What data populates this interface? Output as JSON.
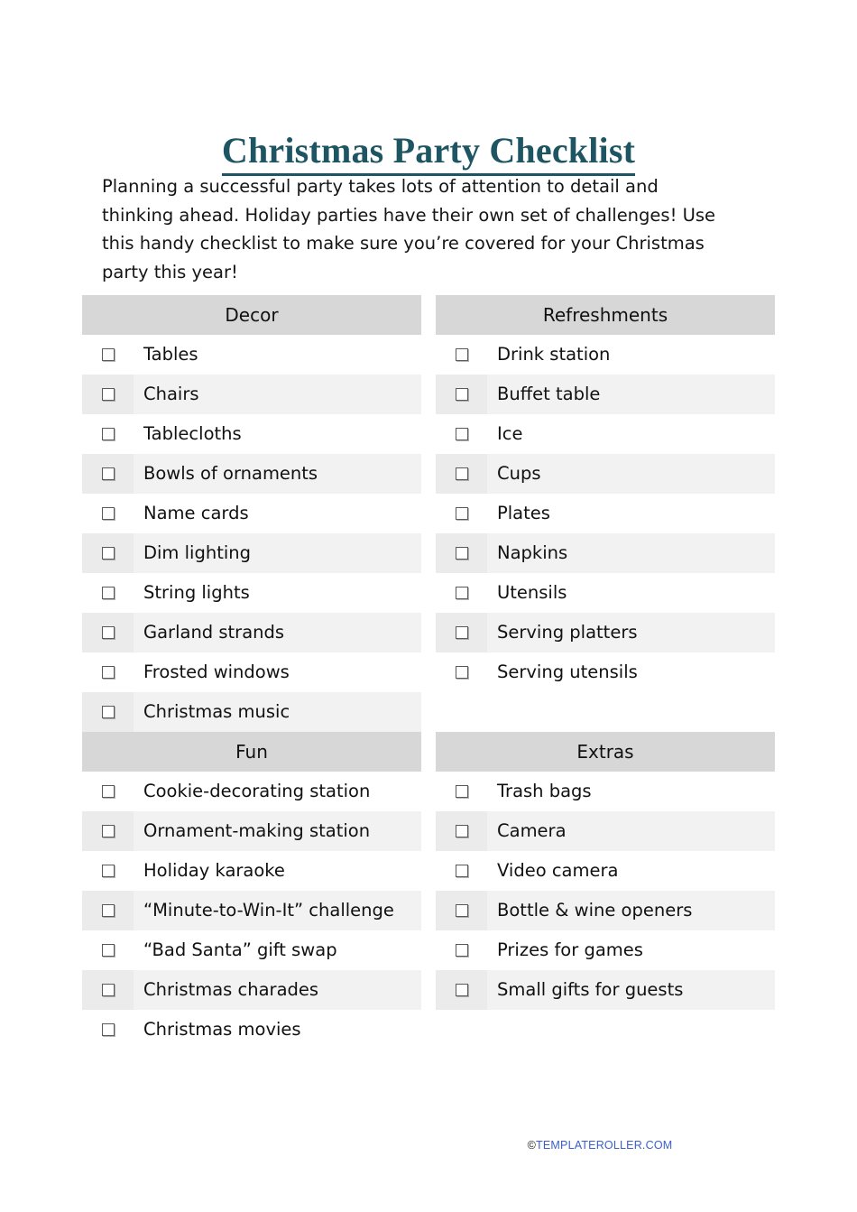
{
  "document": {
    "title": "Christmas Party Checklist",
    "intro_lines": [
      "Planning a successful party takes lots of attention to detail and",
      "thinking ahead. Holiday parties have their own set of challenges! Use",
      "this handy checklist to make sure you’re covered for your Christmas",
      "party this year!"
    ]
  },
  "sections": {
    "decor": {
      "header": "Decor",
      "items": [
        "Tables",
        "Chairs",
        "Tablecloths",
        "Bowls of ornaments",
        "Name cards",
        "Dim lighting",
        "String lights",
        "Garland strands",
        "Frosted windows",
        "Christmas music"
      ]
    },
    "refreshments": {
      "header": "Refreshments",
      "items": [
        "Drink station",
        "Buffet table",
        "Ice",
        "Cups",
        "Plates",
        "Napkins",
        "Utensils",
        "Serving platters",
        "Serving utensils"
      ]
    },
    "fun": {
      "header": "Fun",
      "items": [
        "Cookie-decorating station",
        "Ornament-making station",
        "Holiday karaoke",
        "“Minute-to-Win-It” challenge",
        "“Bad Santa” gift swap",
        "Christmas charades",
        "Christmas movies"
      ]
    },
    "extras": {
      "header": "Extras",
      "items": [
        "Trash bags",
        "Camera",
        "Video camera",
        "Bottle & wine openers",
        "Prizes for games",
        "Small gifts for guests"
      ]
    }
  },
  "footer": {
    "copyright_mark": "©",
    "brand": "TEMPLATEROLLER.COM"
  },
  "colors": {
    "title": "#1d5563",
    "section_header_bg": "#d7d7d7",
    "row_alt_bg": "#f2f2f2",
    "brand_link": "#3b5fc6"
  }
}
